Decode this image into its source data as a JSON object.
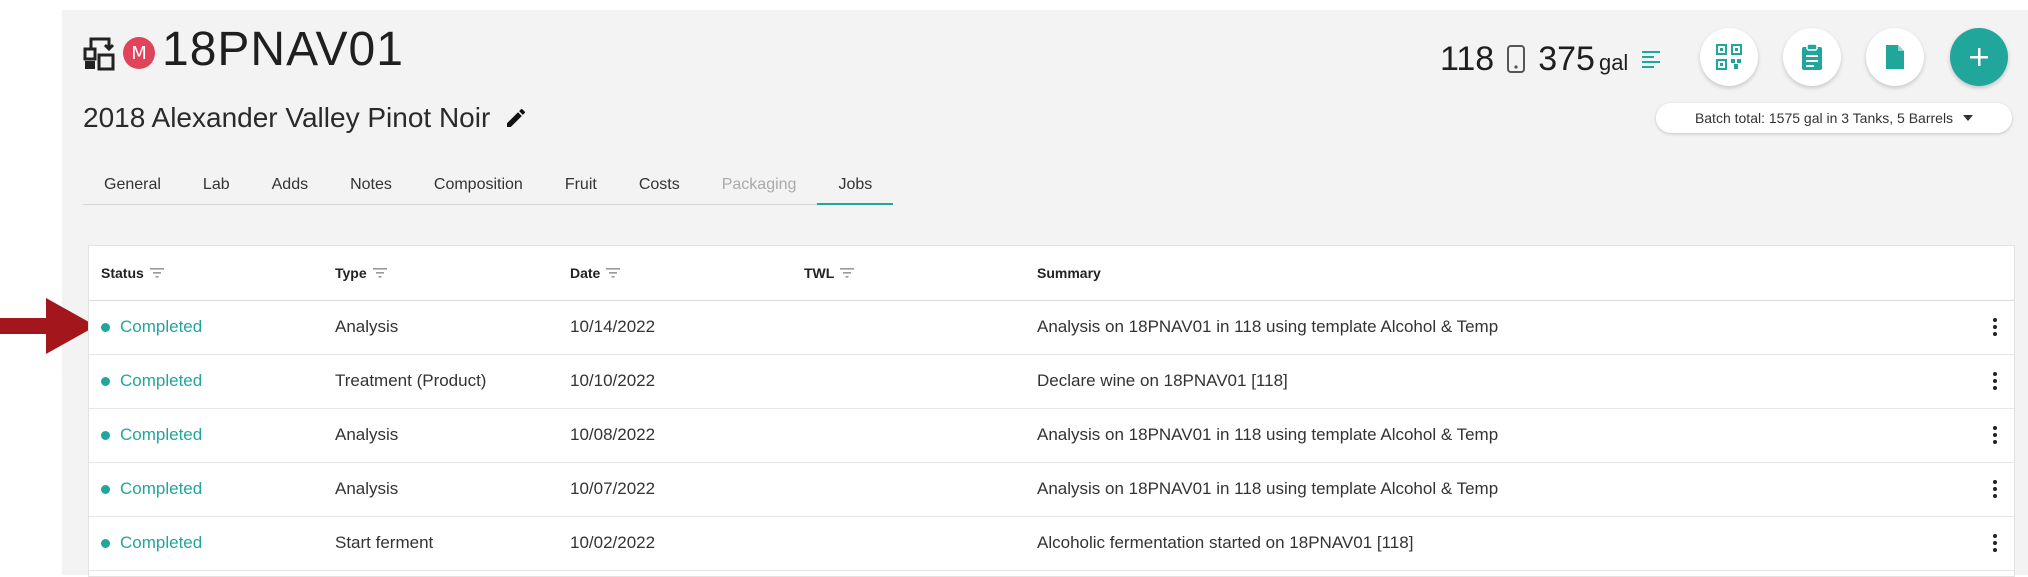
{
  "header": {
    "batch_code": "18PNAV01",
    "badge_letter": "M",
    "batch_name": "2018 Alexander Valley Pinot Noir",
    "vessel": "118",
    "volume": "375",
    "volume_unit": "gal",
    "batch_total": "Batch total: 1575 gal in 3 Tanks, 5 Barrels"
  },
  "tabs": [
    {
      "label": "General",
      "state": "normal"
    },
    {
      "label": "Lab",
      "state": "normal"
    },
    {
      "label": "Adds",
      "state": "normal"
    },
    {
      "label": "Notes",
      "state": "normal"
    },
    {
      "label": "Composition",
      "state": "normal"
    },
    {
      "label": "Fruit",
      "state": "normal"
    },
    {
      "label": "Costs",
      "state": "normal"
    },
    {
      "label": "Packaging",
      "state": "disabled"
    },
    {
      "label": "Jobs",
      "state": "active"
    }
  ],
  "table": {
    "columns": [
      "Status",
      "Type",
      "Date",
      "TWL",
      "Summary"
    ],
    "rows": [
      {
        "status": "Completed",
        "type": "Analysis",
        "date": "10/14/2022",
        "twl": "",
        "summary": "Analysis on 18PNAV01 in 118 using template Alcohol & Temp"
      },
      {
        "status": "Completed",
        "type": "Treatment (Product)",
        "date": "10/10/2022",
        "twl": "",
        "summary": "Declare wine on 18PNAV01 [118]"
      },
      {
        "status": "Completed",
        "type": "Analysis",
        "date": "10/08/2022",
        "twl": "",
        "summary": "Analysis on 18PNAV01 in 118 using template Alcohol & Temp"
      },
      {
        "status": "Completed",
        "type": "Analysis",
        "date": "10/07/2022",
        "twl": "",
        "summary": "Analysis on 18PNAV01 in 118 using template Alcohol & Temp"
      },
      {
        "status": "Completed",
        "type": "Start ferment",
        "date": "10/02/2022",
        "twl": "",
        "summary": "Alcoholic fermentation started on 18PNAV01 [118]"
      }
    ]
  },
  "colors": {
    "accent": "#21a69c",
    "badge": "#e0435a",
    "annotation_arrow": "#a3161c"
  },
  "icons": [
    "batch-icon",
    "edit-icon",
    "phone-icon",
    "list-icon",
    "qr-code-icon",
    "clipboard-icon",
    "document-icon",
    "plus-icon",
    "filter-icon",
    "kebab-menu-icon",
    "annotation-arrow-icon"
  ]
}
